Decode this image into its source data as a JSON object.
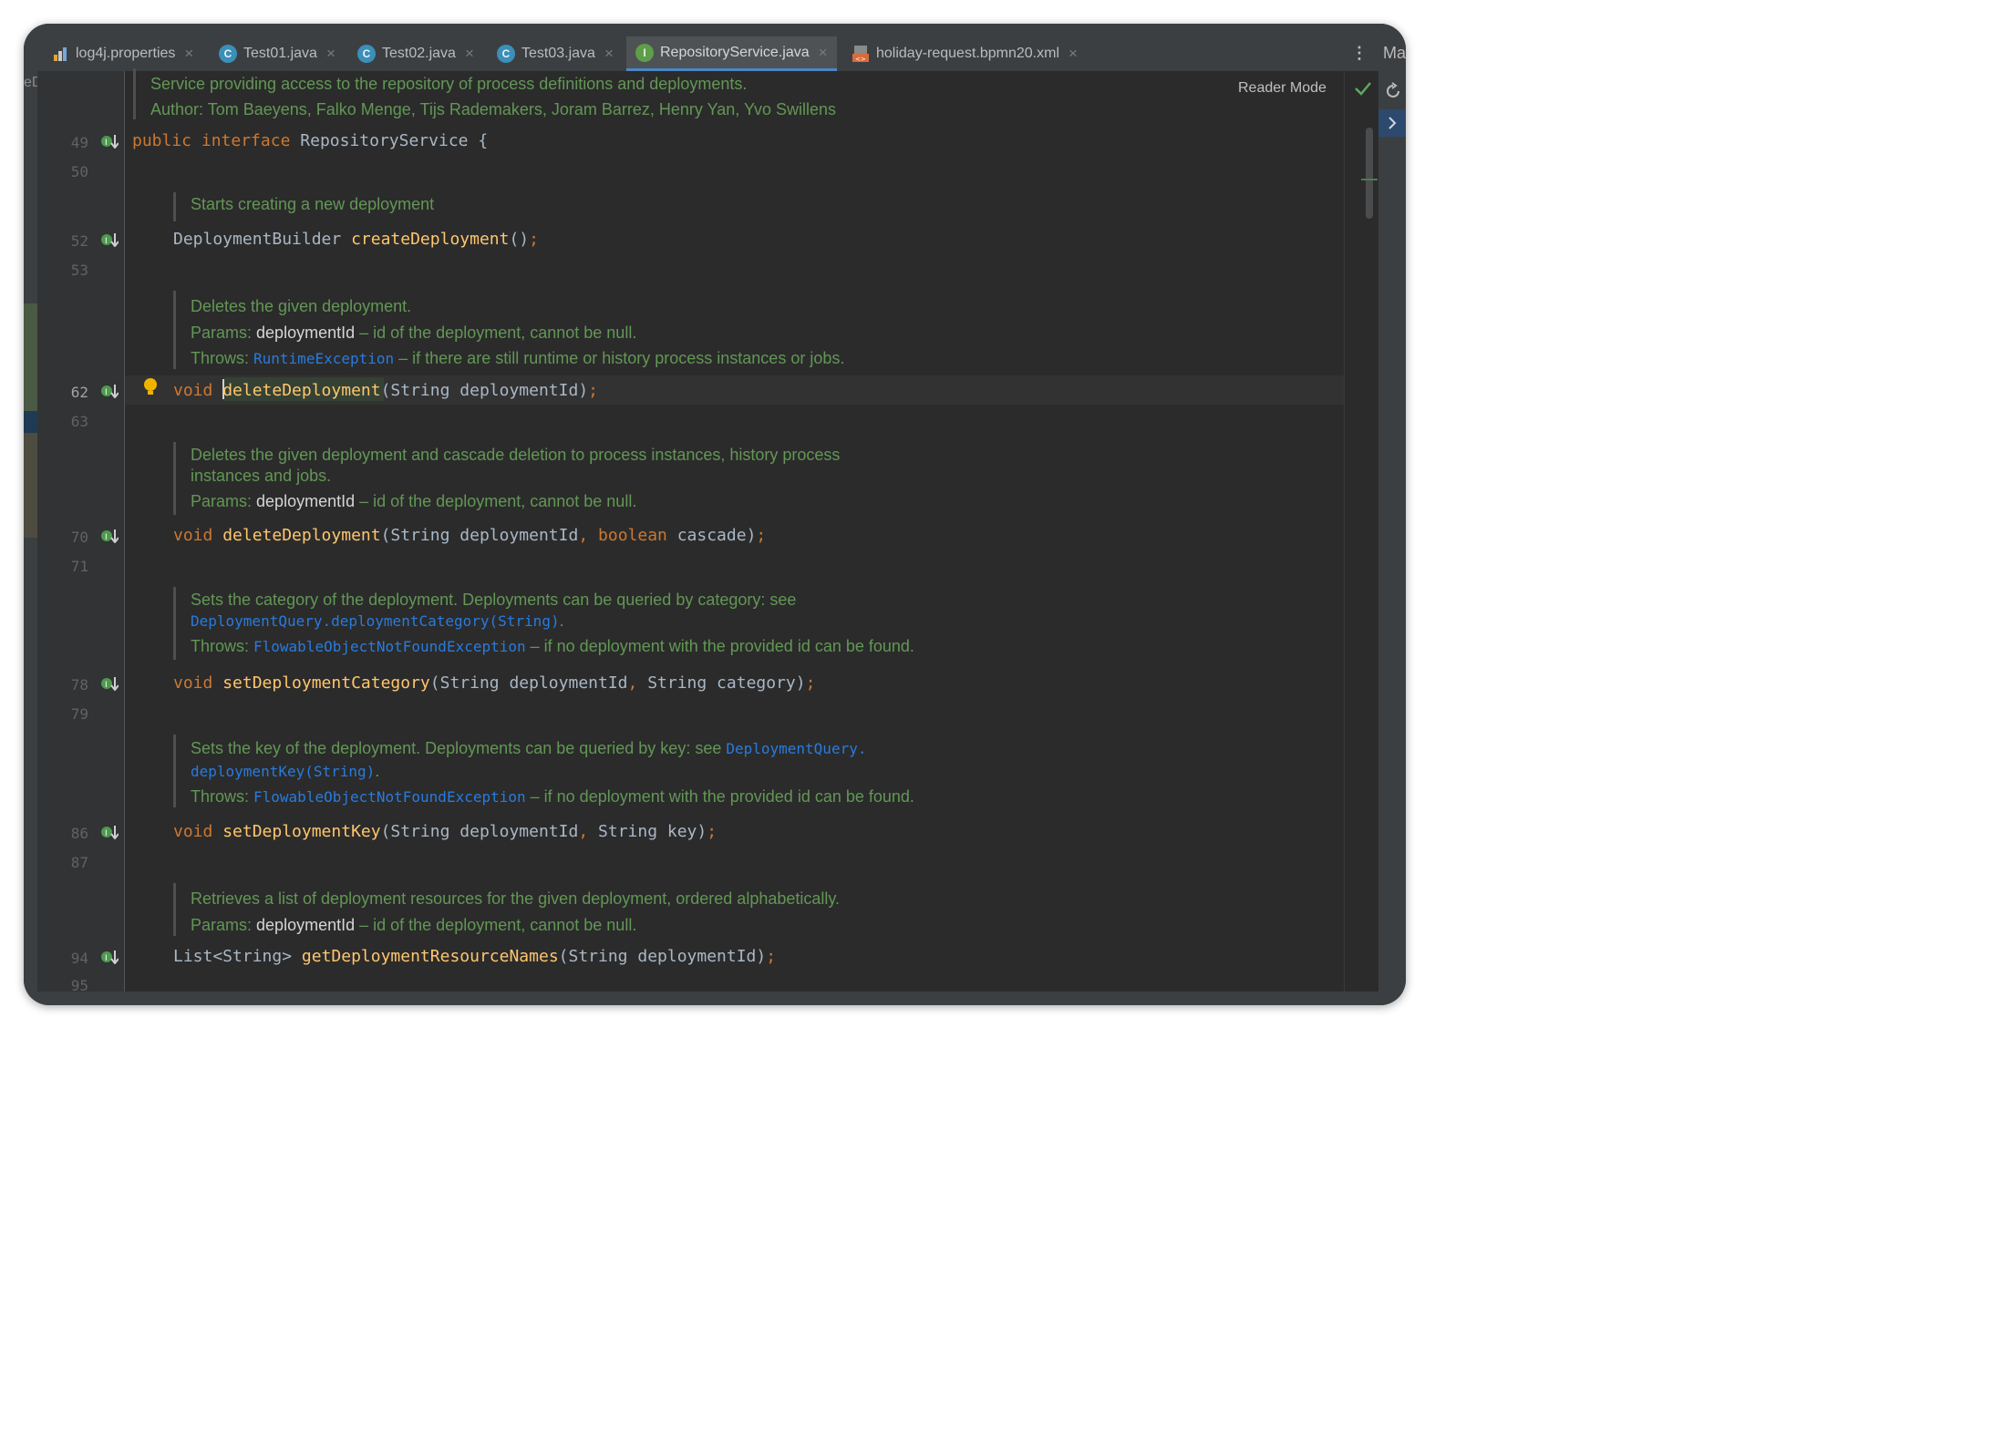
{
  "tabs": [
    {
      "label": "log4j.properties",
      "icon": "properties-file-icon",
      "active": false
    },
    {
      "label": "Test01.java",
      "icon": "java-class-icon",
      "active": false
    },
    {
      "label": "Test02.java",
      "icon": "java-class-icon",
      "active": false
    },
    {
      "label": "Test03.java",
      "icon": "java-class-icon",
      "active": false
    },
    {
      "label": "RepositoryService.java",
      "icon": "java-interface-icon",
      "active": true
    },
    {
      "label": "holiday-request.bpmn20.xml",
      "icon": "xml-file-icon",
      "active": false
    }
  ],
  "tab_overflow_text": "Ma",
  "left_strip_text": "eD",
  "reader_mode": "Reader Mode",
  "header_doc": {
    "line1": "Service providing access to the repository of process definitions and deployments.",
    "line2": "Author: Tom Baeyens, Falko Menge, Tijs Rademakers, Joram Barrez, Henry Yan, Yvo Swillens"
  },
  "line_numbers": {
    "l49": "49",
    "l50": "50",
    "l52": "52",
    "l53": "53",
    "l62": "62",
    "l63": "63",
    "l70": "70",
    "l71": "71",
    "l78": "78",
    "l79": "79",
    "l86": "86",
    "l87": "87",
    "l94": "94",
    "l95": "95"
  },
  "code": {
    "l49": {
      "kw1": "public",
      "kw2": "interface",
      "name": "RepositoryService",
      "rest": " {"
    },
    "l52": {
      "type": "DeploymentBuilder ",
      "fn": "createDeployment",
      "args": "()",
      "semi": ";"
    },
    "l62": {
      "kw": "void ",
      "fn": "deleteDeployment",
      "args": "(String deploymentId)",
      "semi": ";"
    },
    "l70": {
      "kw": "void ",
      "fn": "deleteDeployment",
      "args1": "(String deploymentId",
      "comma": ", ",
      "kw2": "boolean",
      "args2": " cascade)",
      "semi": ";"
    },
    "l78": {
      "kw": "void ",
      "fn": "setDeploymentCategory",
      "args1": "(String deploymentId",
      "comma": ", ",
      "args2": "String category)",
      "semi": ";"
    },
    "l86": {
      "kw": "void ",
      "fn": "setDeploymentKey",
      "args1": "(String deploymentId",
      "comma": ", ",
      "args2": "String key)",
      "semi": ";"
    },
    "l94": {
      "type": "List<String> ",
      "fn": "getDeploymentResourceNames",
      "args": "(String deploymentId)",
      "semi": ";"
    }
  },
  "docs": {
    "d1": {
      "text": "Starts creating a new deployment"
    },
    "d2": {
      "line1": "Deletes the given deployment.",
      "params_label": "Params: ",
      "params_name": "deploymentId",
      "params_desc": " – id of the deployment, cannot be null.",
      "throws_label": "Throws: ",
      "throws_link": "RuntimeException",
      "throws_desc": " – if there are still runtime or history process instances or jobs."
    },
    "d3": {
      "line1": "Deletes the given deployment and cascade deletion to process instances, history process",
      "line2": "instances and jobs.",
      "params_label": "Params: ",
      "params_name": "deploymentId",
      "params_desc": " – id of the deployment, cannot be null."
    },
    "d4": {
      "line1": "Sets the category of the deployment. Deployments can be queried by category: see",
      "line2_link": "DeploymentQuery.deploymentCategory(String)",
      "line2_end": ".",
      "throws_label": "Throws: ",
      "throws_link": "FlowableObjectNotFoundException",
      "throws_desc": " – if no deployment with the provided id can be found."
    },
    "d5": {
      "line1": "Sets the key of the deployment. Deployments can be queried by key: see ",
      "line1_link": "DeploymentQuery.",
      "line2_link": "deploymentKey(String)",
      "line2_end": ".",
      "throws_label": "Throws: ",
      "throws_link": "FlowableObjectNotFoundException",
      "throws_desc": " – if no deployment with the provided id can be found."
    },
    "d6": {
      "line1": "Retrieves a list of deployment resources for the given deployment, ordered alphabetically.",
      "params_label": "Params: ",
      "params_name": "deploymentId",
      "params_desc": " – id of the deployment, cannot be null."
    }
  },
  "colors": {
    "editor_bg": "#2b2b2b",
    "keyword": "#cc7832",
    "function": "#ffc66d",
    "doc_text": "#629755",
    "doc_link": "#287bde",
    "active_tab_underline": "#4a88c7"
  }
}
